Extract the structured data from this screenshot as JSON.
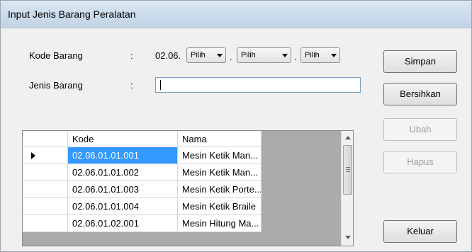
{
  "window": {
    "title": "Input Jenis Barang Peralatan"
  },
  "form": {
    "kode_label": "Kode Barang",
    "jenis_label": "Jenis Barang",
    "colon": ":",
    "kode_prefix": "02.06.",
    "dot": ".",
    "combo1": "Pilih",
    "combo2": "Pilih",
    "combo3": "Pilih",
    "jenis_value": ""
  },
  "buttons": {
    "simpan": "Simpan",
    "bersihkan": "Bersihkan",
    "ubah": "Ubah",
    "hapus": "Hapus",
    "keluar": "Keluar"
  },
  "grid": {
    "columns": [
      "Kode",
      "Nama"
    ],
    "rows": [
      {
        "kode": "02.06.01.01.001",
        "nama": "Mesin Ketik Man..."
      },
      {
        "kode": "02.06.01.01.002",
        "nama": "Mesin Ketik Man..."
      },
      {
        "kode": "02.06.01.01.003",
        "nama": "Mesin Ketik Porte..."
      },
      {
        "kode": "02.06.01.01.004",
        "nama": "Mesin Ketik Braile"
      },
      {
        "kode": "02.06.01.02.001",
        "nama": "Mesin Hitung Ma..."
      }
    ]
  },
  "colors": {
    "selection": "#3399ff",
    "grid_background": "#ababab"
  }
}
